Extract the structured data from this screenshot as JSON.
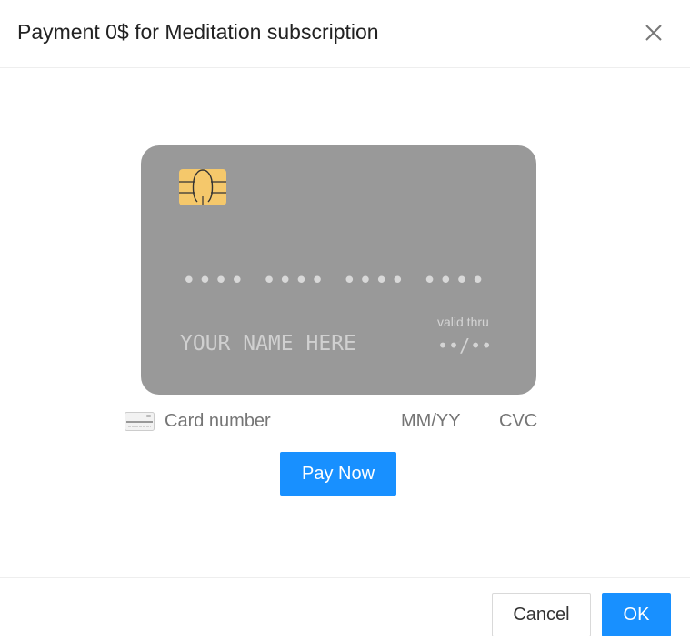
{
  "modal": {
    "title": "Payment 0$ for Meditation subscription"
  },
  "card_preview": {
    "number": "•••• •••• •••• ••••",
    "name": "YOUR NAME HERE",
    "valid_label": "valid thru",
    "valid_value": "••/••"
  },
  "card_input": {
    "number_placeholder": "Card number",
    "expiry_placeholder": "MM/YY",
    "cvc_placeholder": "CVC"
  },
  "actions": {
    "pay_label": "Pay Now"
  },
  "footer": {
    "cancel_label": "Cancel",
    "ok_label": "OK"
  },
  "colors": {
    "primary": "#1890ff",
    "card_background": "#999999",
    "chip": "#f5c86b"
  },
  "icons": {
    "close": "close-icon",
    "chip": "card-chip-icon",
    "card": "credit-card-icon"
  }
}
